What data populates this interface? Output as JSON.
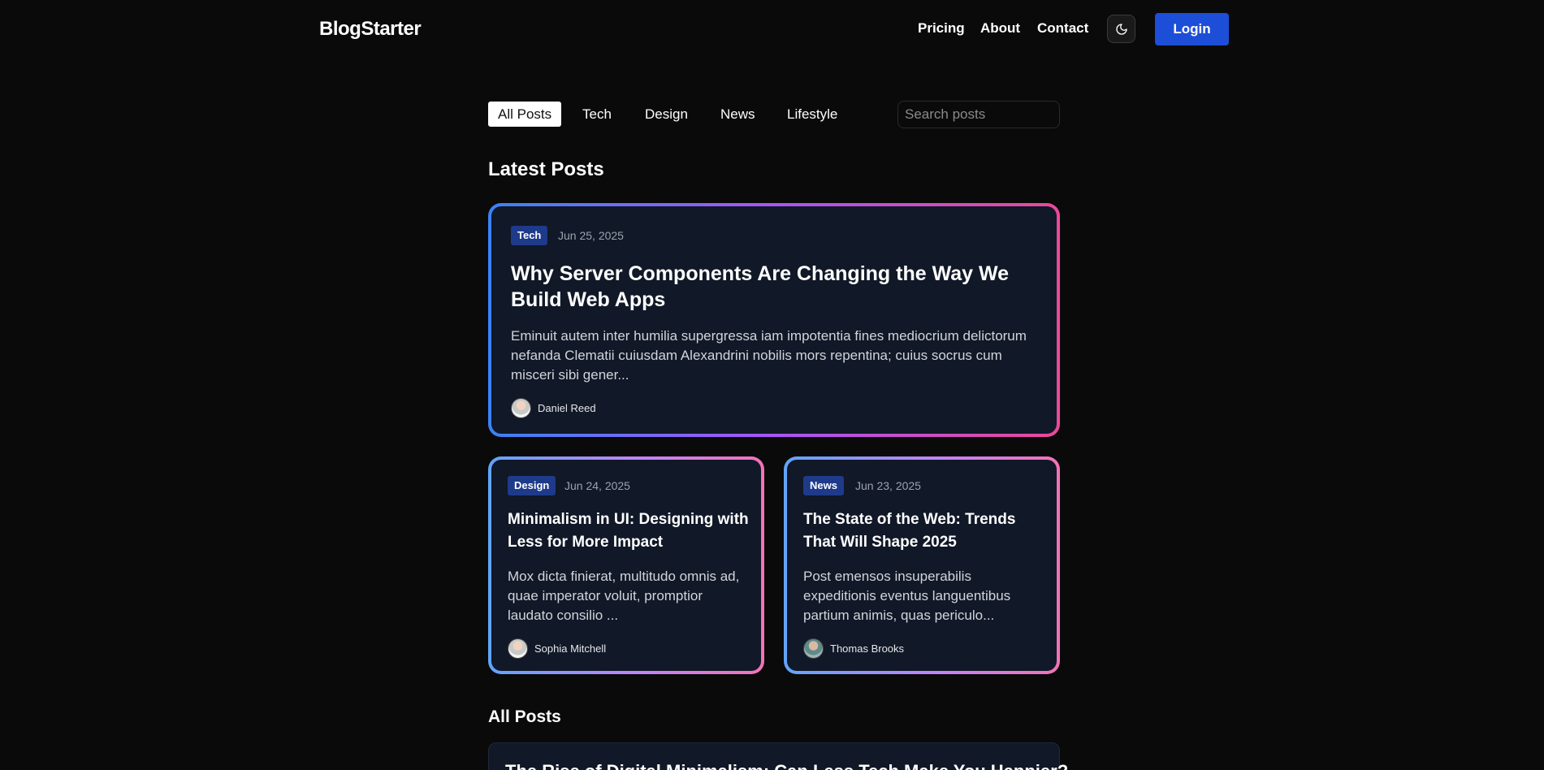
{
  "header": {
    "logo": "BlogStarter",
    "nav": [
      "Pricing",
      "About",
      "Contact"
    ],
    "login_label": "Login",
    "theme_icon": "moon-icon"
  },
  "filters": {
    "items": [
      "All Posts",
      "Tech",
      "Design",
      "News",
      "Lifestyle"
    ],
    "active": "All Posts",
    "search_placeholder": "Search posts"
  },
  "latest": {
    "title": "Latest Posts",
    "featured": {
      "tag": "Tech",
      "date": "Jun 25, 2025",
      "title": "Why Server Components Are Changing the Way We Build Web Apps",
      "excerpt": "Eminuit autem inter humilia supergressa iam impotentia fines mediocrium delictorum nefanda Clematii cuiusdam Alexandrini nobilis mors repentina; cuius socrus cum misceri sibi gener...",
      "author": "Daniel Reed"
    },
    "cards": [
      {
        "tag": "Design",
        "date": "Jun 24, 2025",
        "title": "Minimalism in UI: Designing with Less for More Impact",
        "excerpt": "Mox dicta finierat, multitudo omnis ad, quae imperator voluit, promptior laudato consilio ...",
        "author": "Sophia Mitchell"
      },
      {
        "tag": "News",
        "date": "Jun 23, 2025",
        "title": "The State of the Web: Trends That Will Shape 2025",
        "excerpt": "Post emensos insuperabilis expeditionis eventus languentibus partium animis, quas periculo...",
        "author": "Thomas Brooks"
      }
    ]
  },
  "all_posts": {
    "title": "All Posts",
    "first_title": "The Rise of Digital Minimalism: Can Less Tech Make You Happier?"
  },
  "colors": {
    "background": "#0a0a0a",
    "card": "#111827",
    "accent": "#1d4ed8",
    "tag": "#1e3a8a",
    "gradient_start": "#3b82f6",
    "gradient_end": "#ec4899"
  }
}
